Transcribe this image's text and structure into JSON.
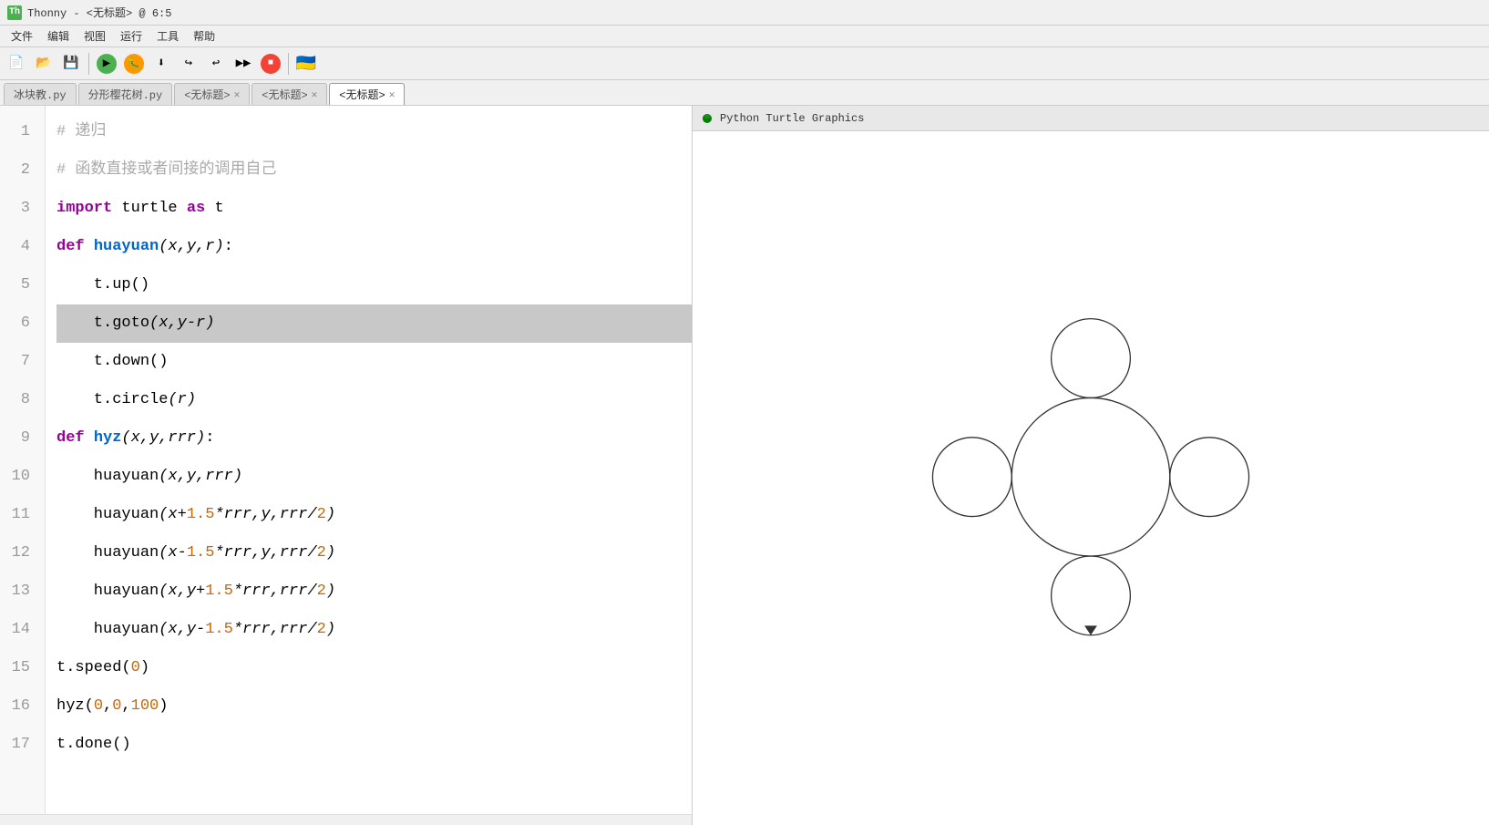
{
  "titleBar": {
    "icon": "Th",
    "title": "Thonny - <无标题> @ 6:5"
  },
  "menuBar": {
    "items": [
      "文件",
      "编辑",
      "视图",
      "运行",
      "工具",
      "帮助"
    ]
  },
  "tabs": [
    {
      "label": "冰块教.py",
      "active": false,
      "closable": false
    },
    {
      "label": "分形樱花树.py",
      "active": false,
      "closable": false
    },
    {
      "label": "<无标题>",
      "active": false,
      "closable": true
    },
    {
      "label": "<无标题>",
      "active": false,
      "closable": true
    },
    {
      "label": "<无标题>",
      "active": true,
      "closable": true
    }
  ],
  "codeLines": [
    {
      "num": 1,
      "content": "# 递归",
      "type": "comment"
    },
    {
      "num": 2,
      "content": "# 函数直接或者间接的调用自己",
      "type": "comment"
    },
    {
      "num": 3,
      "content": "import turtle as t",
      "type": "code"
    },
    {
      "num": 4,
      "content": "def huayuan(x,y,r):",
      "type": "code"
    },
    {
      "num": 5,
      "content": "    t.up()",
      "type": "code"
    },
    {
      "num": 6,
      "content": "    t.goto(x,y-r)",
      "type": "code",
      "highlighted": true
    },
    {
      "num": 7,
      "content": "    t.down()",
      "type": "code"
    },
    {
      "num": 8,
      "content": "    t.circle(r)",
      "type": "code"
    },
    {
      "num": 9,
      "content": "def hyz(x,y,rrr):",
      "type": "code"
    },
    {
      "num": 10,
      "content": "    huayuan(x,y,rrr)",
      "type": "code"
    },
    {
      "num": 11,
      "content": "    huayuan(x+1.5*rrr,y,rrr/2)",
      "type": "code"
    },
    {
      "num": 12,
      "content": "    huayuan(x-1.5*rrr,y,rrr/2)",
      "type": "code"
    },
    {
      "num": 13,
      "content": "    huayuan(x,y+1.5*rrr,rrr/2)",
      "type": "code"
    },
    {
      "num": 14,
      "content": "    huayuan(x,y-1.5*rrr,rrr/2)",
      "type": "code"
    },
    {
      "num": 15,
      "content": "t.speed(0)",
      "type": "code"
    },
    {
      "num": 16,
      "content": "hyz(0,0,100)",
      "type": "code"
    },
    {
      "num": 17,
      "content": "t.done()",
      "type": "code"
    }
  ],
  "turtleWindow": {
    "title": "Python Turtle Graphics"
  },
  "colors": {
    "keyword": "#990099",
    "function": "#0066cc",
    "comment": "#aaaaaa",
    "number": "#cc6600",
    "highlight_bg": "#c8c8c8"
  }
}
